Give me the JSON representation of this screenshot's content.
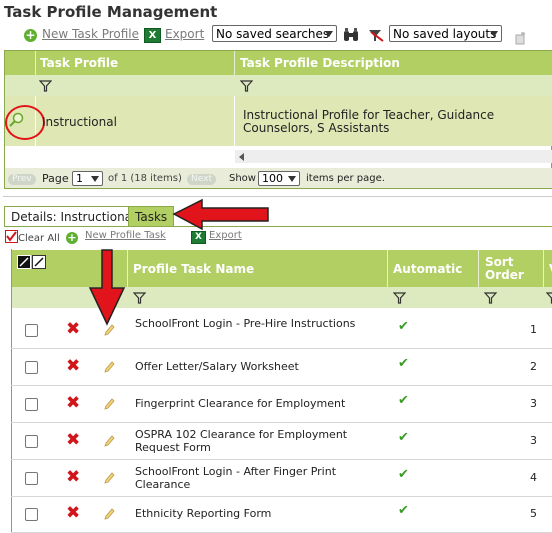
{
  "page": {
    "title": "Task Profile Management"
  },
  "toolbar": {
    "new_profile": "New Task Profile",
    "export": "Export",
    "saved_searches": "No saved searches",
    "saved_layouts": "No saved layouts"
  },
  "profile_grid": {
    "col_profile": "Task Profile",
    "col_description": "Task Profile Description",
    "row": {
      "name": "Instructional",
      "description": "Instructional Profile for Teacher, Guidance Counselors, S Assistants"
    },
    "pager": {
      "prev": "Prev",
      "page_label": "Page",
      "page_value": "1",
      "of_text": "of 1 (18 items)",
      "next": "Next",
      "show_label": "Show",
      "show_value": "100",
      "per_page": "items per page."
    }
  },
  "tabs": {
    "details": "Details: Instructional",
    "tasks": "Tasks"
  },
  "task_toolbar": {
    "clear_all": "Clear All",
    "new_profile_task": "New Profile Task",
    "export": "Export"
  },
  "task_grid": {
    "col_name": "Profile Task Name",
    "col_automatic": "Automatic",
    "col_sort_order_1": "Sort",
    "col_sort_order_2": "Order",
    "col_extra": "V",
    "rows": [
      {
        "name": "SchoolFront Login - Pre-Hire Instructions",
        "automatic": "✔",
        "sort": "1"
      },
      {
        "name": "Offer Letter/Salary Worksheet",
        "automatic": "✔",
        "sort": "2"
      },
      {
        "name": "Fingerprint Clearance for Employment",
        "automatic": "✔",
        "sort": "3"
      },
      {
        "name": "OSPRA 102 Clearance for Employment Request Form",
        "automatic": "✔",
        "sort": "3"
      },
      {
        "name": "SchoolFront Login - After Finger Print Clearance",
        "automatic": "✔",
        "sort": "4"
      },
      {
        "name": "Ethnicity Reporting Form",
        "automatic": "✔",
        "sort": "5"
      }
    ]
  },
  "colors": {
    "header_green": "#b2cf63",
    "filter_green": "#dde9be",
    "annotation_red": "#e0141a"
  }
}
